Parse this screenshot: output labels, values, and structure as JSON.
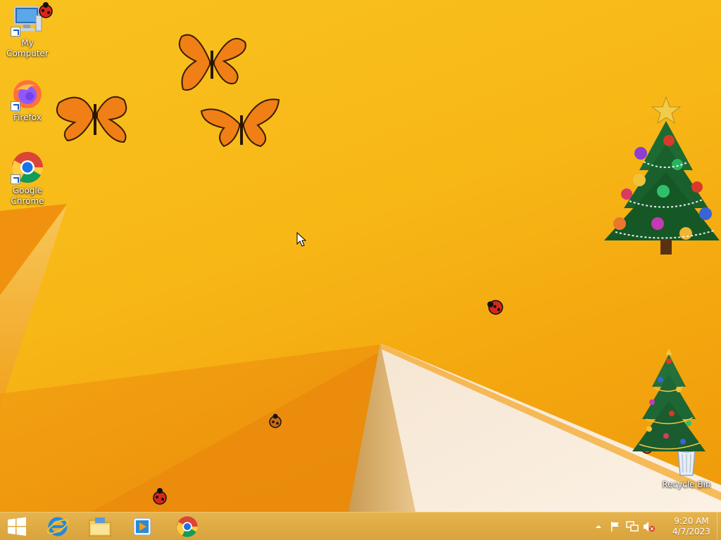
{
  "desktop": {
    "icons": [
      {
        "label": "My Computer",
        "icon": "computer-icon"
      },
      {
        "label": "Firefox",
        "icon": "firefox-icon"
      },
      {
        "label": "Google Chrome",
        "icon": "chrome-icon"
      },
      {
        "label": "Recycle Bin",
        "icon": "recycle-bin-icon"
      }
    ]
  },
  "taskbar": {
    "pinned": [
      {
        "icon": "start-windows-icon"
      },
      {
        "icon": "internet-explorer-icon"
      },
      {
        "icon": "file-explorer-icon"
      },
      {
        "icon": "media-player-icon"
      },
      {
        "icon": "chrome-icon"
      }
    ],
    "tray": {
      "icons": [
        "show-hidden-icons-arrow",
        "action-center-flag-icon",
        "network-icon",
        "volume-muted-icon"
      ],
      "time": "9:20 AM",
      "date": "4/7/2023"
    }
  },
  "colors": {
    "wallpaper": "#f7b716",
    "taskbar": "#dcaa44"
  }
}
